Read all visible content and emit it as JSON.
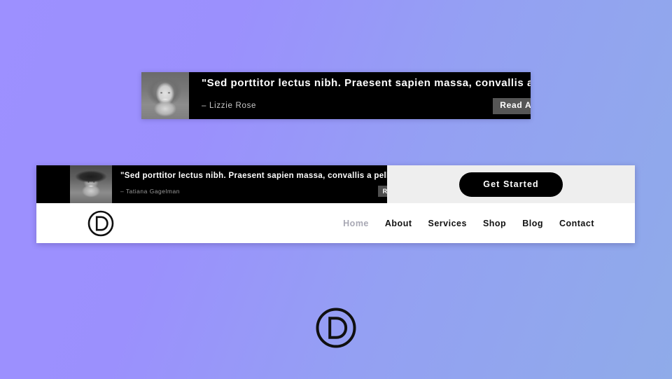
{
  "background": {
    "gradient_from": "#9d90ff",
    "gradient_to": "#8fabe9"
  },
  "top_banner": {
    "name": "testimonial-banner-preview",
    "background_color": "#000000",
    "avatar_alt": "lizzie-rose-portrait",
    "quote": "\"Sed porttitor lectus nibh. Praesent sapien massa, convallis a…",
    "author": "– Lizzie Rose",
    "read_all_label": "Read All",
    "read_all_color": "#565656"
  },
  "header_card": {
    "utility_bar": {
      "promo": {
        "avatar_alt": "tatiana-gagelman-portrait",
        "quote": "\"Sed porttitor lectus nibh. Praesent sapien massa, convallis a pellente…",
        "author": "– Tatiana Gagelman",
        "read_all_label": "Read All"
      },
      "cta_label": "Get Started",
      "cta_color": "#000000",
      "background_color": "#eeeeee"
    },
    "nav": {
      "logo_letter": "D",
      "links": [
        {
          "label": "Home",
          "active": true
        },
        {
          "label": "About",
          "active": false
        },
        {
          "label": "Services",
          "active": false
        },
        {
          "label": "Shop",
          "active": false
        },
        {
          "label": "Blog",
          "active": false
        },
        {
          "label": "Contact",
          "active": false
        }
      ],
      "active_color": "#a8a8b4",
      "link_color": "#111111"
    }
  },
  "bottom_logo": {
    "letter": "D",
    "color": "#101010"
  }
}
